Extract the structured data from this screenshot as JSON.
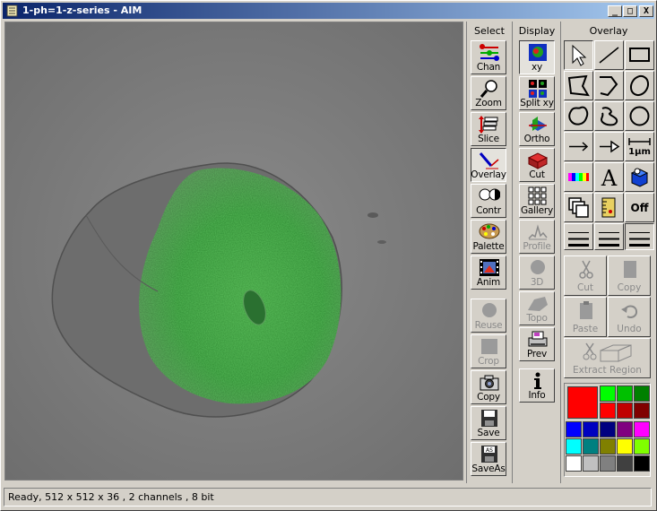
{
  "window": {
    "title": "1-ph=1-z-series - AIM",
    "minimize": "_",
    "maximize": "□",
    "close": "X"
  },
  "select_panel": {
    "header": "Select",
    "buttons": [
      {
        "label": "Chan",
        "icon": "channels-icon",
        "enabled": true
      },
      {
        "label": "Zoom",
        "icon": "magnifier-icon",
        "enabled": true
      },
      {
        "label": "Slice",
        "icon": "slice-icon",
        "enabled": true
      },
      {
        "label": "Overlay",
        "icon": "overlay-pen-icon",
        "enabled": true,
        "pressed": true
      },
      {
        "label": "Contr",
        "icon": "contrast-icon",
        "enabled": true
      },
      {
        "label": "Palette",
        "icon": "palette-icon",
        "enabled": true
      },
      {
        "label": "Anim",
        "icon": "film-icon",
        "enabled": true
      },
      {
        "label": "Reuse",
        "icon": "reuse-icon",
        "enabled": false
      },
      {
        "label": "Crop",
        "icon": "crop-icon",
        "enabled": false
      },
      {
        "label": "Copy",
        "icon": "camera-icon",
        "enabled": true
      },
      {
        "label": "Save",
        "icon": "floppy-icon",
        "enabled": true
      },
      {
        "label": "SaveAs",
        "icon": "floppy-as-icon",
        "enabled": true
      }
    ]
  },
  "display_panel": {
    "header": "Display",
    "buttons": [
      {
        "label": "xy",
        "icon": "xy-icon",
        "enabled": true,
        "pressed": true
      },
      {
        "label": "Split xy",
        "icon": "split-xy-icon",
        "enabled": true
      },
      {
        "label": "Ortho",
        "icon": "ortho-icon",
        "enabled": true
      },
      {
        "label": "Cut",
        "icon": "cut-box-icon",
        "enabled": true
      },
      {
        "label": "Gallery",
        "icon": "gallery-grid-icon",
        "enabled": true
      },
      {
        "label": "Profile",
        "icon": "profile-icon",
        "enabled": false
      },
      {
        "label": "3D",
        "icon": "sphere-icon",
        "enabled": false
      },
      {
        "label": "Topo",
        "icon": "topo-icon",
        "enabled": false
      },
      {
        "label": "Prev",
        "icon": "printer-icon",
        "enabled": true
      },
      {
        "label": "Info",
        "icon": "info-icon",
        "enabled": true
      }
    ]
  },
  "overlay_panel": {
    "header": "Overlay",
    "tools": [
      "arrow-pointer-icon",
      "line-icon",
      "rectangle-icon",
      "polygon-icon",
      "polyline-icon",
      "ellipse-icon",
      "closed-freehand-icon",
      "open-freehand-icon",
      "circle-icon",
      "arrow-line-icon",
      "arrowhead-line-icon",
      "scale-bar-icon",
      "color-bar-icon",
      "text-icon",
      "color-cube-icon",
      "copy-layers-icon",
      "ruler-icon",
      "off-icon"
    ],
    "scale_bar_label": "1µm",
    "text_glyph": "A",
    "off_label": "Off",
    "edit": {
      "cut": "Cut",
      "copy": "Copy",
      "paste": "Paste",
      "undo": "Undo",
      "extract": "Extract Region"
    },
    "current_color": "#ff0000",
    "palette": [
      "#00ff00",
      "#00c000",
      "#008000",
      "#ff0000",
      "#c00000",
      "#800000",
      "#0000ff",
      "#0000c0",
      "#000080",
      "#800080",
      "#ff00ff",
      "#00ffff",
      "#008080",
      "#808000",
      "#ffff00",
      "#80ff00",
      "#ffffff",
      "#c0c0c0",
      "#808080",
      "#404040",
      "#000000"
    ]
  },
  "status": {
    "text": "Ready, 512 x 512 x 36 , 2 channels , 8 bit"
  }
}
